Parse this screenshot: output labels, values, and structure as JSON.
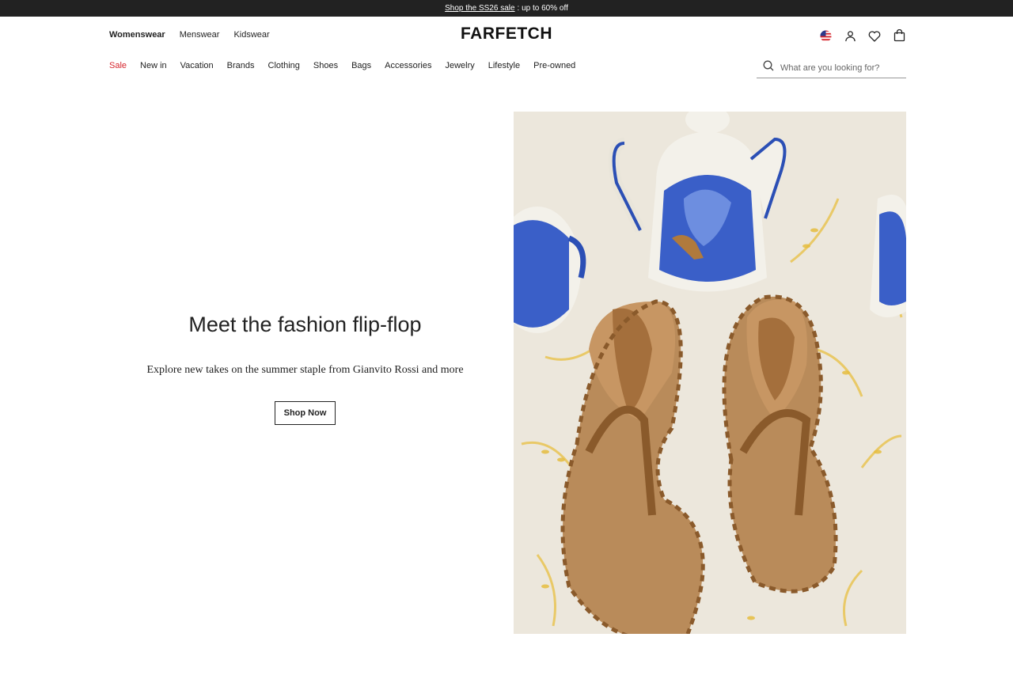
{
  "promo": {
    "link_text": "Shop the SS26 sale",
    "suffix": ": up to 60% off"
  },
  "header": {
    "logo": "FARFETCH",
    "gender_tabs": [
      "Womenswear",
      "Menswear",
      "Kidswear"
    ],
    "icons": [
      "us-flag-icon",
      "account-icon",
      "wishlist-heart-icon",
      "bag-icon"
    ]
  },
  "nav": {
    "items": [
      "Sale",
      "New in",
      "Vacation",
      "Brands",
      "Clothing",
      "Shoes",
      "Bags",
      "Accessories",
      "Jewelry",
      "Lifestyle",
      "Pre-owned"
    ]
  },
  "search": {
    "placeholder": "What are you looking for?"
  },
  "hero": {
    "title": "Meet the fashion flip-flop",
    "subtitle": "Explore new takes on the summer staple from Gianvito Rossi and more",
    "cta": "Shop Now",
    "image_brand_imprint": "Gianvito Rossi"
  },
  "colors": {
    "sale": "#d6262e",
    "promo_bg": "#222222",
    "sandal": "#a67a4a",
    "ceramic_blue": "#2b4fb5"
  }
}
